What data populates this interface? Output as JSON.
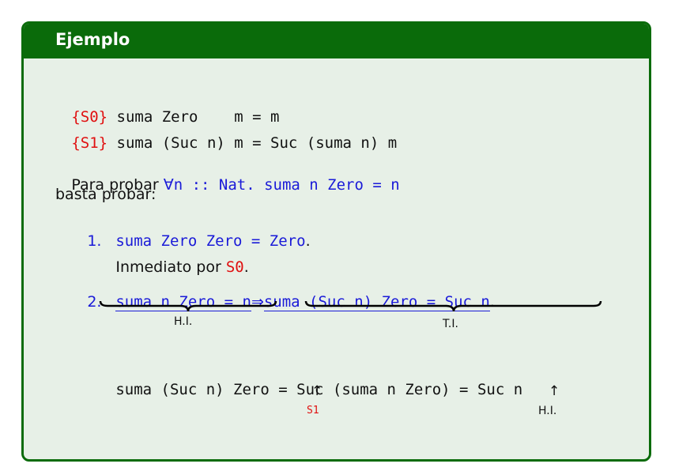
{
  "block": {
    "title": "Ejemplo"
  },
  "rules": [
    {
      "tag": "{S0}",
      "text": " suma Zero    m = m"
    },
    {
      "tag": "{S1}",
      "text": " suma (Suc n) m = Suc (suma n) m"
    }
  ],
  "statement": {
    "prefix": "Para probar ",
    "forall": "∀",
    "formula": "n :: Nat. suma n Zero = n",
    "line2": "basta probar:"
  },
  "items": [
    {
      "num": "1.",
      "formula": "suma Zero Zero = Zero",
      "end": ".",
      "note_prefix": "Inmediato por ",
      "note_ref": "S0",
      "note_end": "."
    },
    {
      "num": "2.",
      "hi_formula": "suma n Zero = n",
      "implies": "⇒",
      "ti_formula": "suma (Suc n) Zero = Suc n",
      "end": ".",
      "hi_label": "H.I.",
      "ti_label": "T.I."
    }
  ],
  "proof": {
    "part1": "suma (Suc n) Zero ",
    "eq1": "=",
    "part2": " Suc (suma n Zero) ",
    "eq2": "=",
    "part3": " Suc n",
    "arrow": "↑",
    "just1": "S1",
    "just2": "H.I."
  }
}
